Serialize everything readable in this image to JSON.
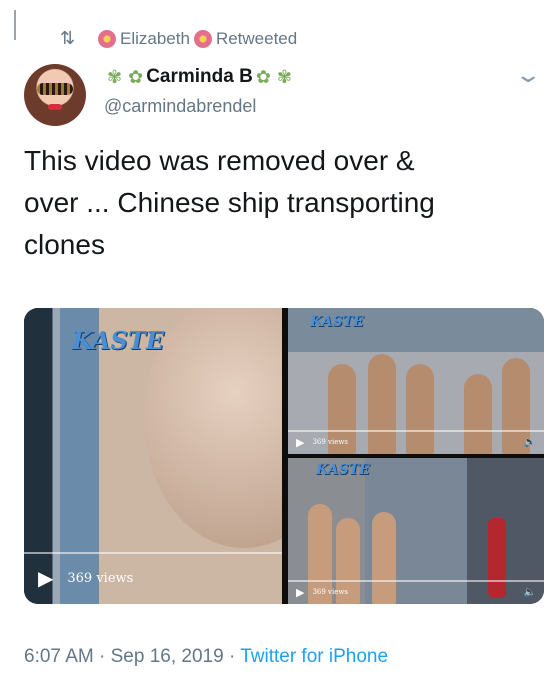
{
  "retweet": {
    "icon": "retweet-icon",
    "user": "Elizabeth",
    "label": "Retweeted"
  },
  "author": {
    "name": "Carminda B",
    "handle": "@carmindabrendel"
  },
  "tweet": {
    "lines": [
      "This video was removed over &",
      "over ... Chinese ship transporting",
      "clones"
    ]
  },
  "media": {
    "left": {
      "views": "369 views",
      "logo": "KASTE"
    },
    "top_right": {
      "logo": "KASTE",
      "views": "369 views"
    },
    "bottom_right": {
      "logo": "KASTE",
      "views": "369 views"
    }
  },
  "meta": {
    "time": "6:07 AM",
    "date": "Sep 16, 2019",
    "source": "Twitter for iPhone",
    "sep": "·"
  },
  "colors": {
    "link": "#1da1f2",
    "muted": "#657786"
  }
}
